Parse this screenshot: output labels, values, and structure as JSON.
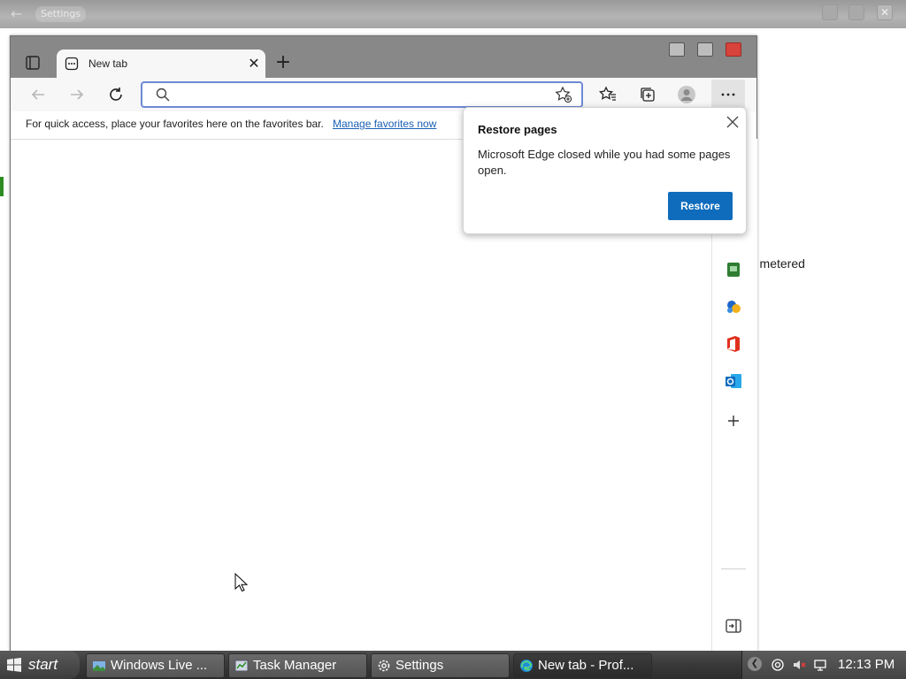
{
  "background_window": {
    "title": "Settings",
    "partial_text": "r metered"
  },
  "edge": {
    "tab": {
      "title": "New tab"
    },
    "address_bar": {
      "value": "",
      "placeholder": ""
    },
    "favorites_bar": {
      "message": "For quick access, place your favorites here on the favorites bar.",
      "link": "Manage favorites now"
    },
    "sidebar_icons": [
      "shopping-icon",
      "games-icon",
      "office-icon",
      "outlook-icon",
      "add-icon",
      "hide-sidebar-icon",
      "gear-icon"
    ]
  },
  "restore_popup": {
    "title": "Restore pages",
    "message": "Microsoft Edge closed while you had some pages open.",
    "button": "Restore",
    "accent": "#0f6cbd"
  },
  "taskbar": {
    "start_label": "start",
    "buttons": [
      {
        "label": "Windows Live ...",
        "icon": "windows-live-icon"
      },
      {
        "label": "Task Manager",
        "icon": "task-manager-icon"
      },
      {
        "label": "Settings",
        "icon": "gear-icon"
      },
      {
        "label": "New tab - Prof...",
        "icon": "edge-icon",
        "active": true
      }
    ],
    "clock": "12:13 PM"
  }
}
